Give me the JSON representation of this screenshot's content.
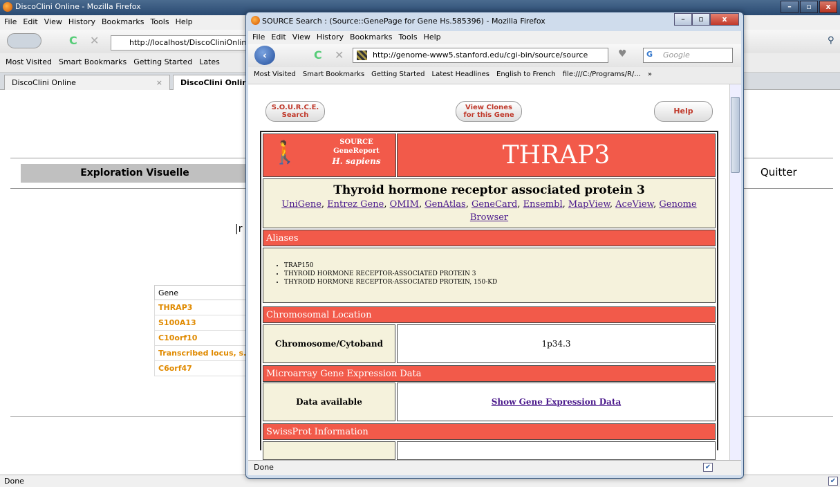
{
  "bg_window": {
    "title": "DiscoClini Online - Mozilla Firefox",
    "menu": [
      "File",
      "Edit",
      "View",
      "History",
      "Bookmarks",
      "Tools",
      "Help"
    ],
    "url": "http://localhost/DiscoCliniOnline",
    "bookmarks": [
      "Most Visited",
      "Smart Bookmarks",
      "Getting Started",
      "Lates"
    ],
    "tabs": [
      "DiscoClini Online",
      "DiscoClini Onlin"
    ],
    "explore_label": "Exploration Visuelle",
    "quit_label": "Quitter",
    "pipe_text": "|r",
    "gene_table": {
      "header": "Gene",
      "rows": [
        "THRAP3",
        "S100A13",
        "C10orf10",
        "Transcribed locus, s.",
        "C6orf47"
      ]
    },
    "status": "Done"
  },
  "popup": {
    "title": "SOURCE Search : (Source::GenePage for Gene Hs.585396) - Mozilla Firefox",
    "menu": [
      "File",
      "Edit",
      "View",
      "History",
      "Bookmarks",
      "Tools",
      "Help"
    ],
    "url": "http://genome-www5.stanford.edu/cgi-bin/source/source",
    "search_placeholder": "Google",
    "bookmarks": [
      "Most Visited",
      "Smart Bookmarks",
      "Getting Started",
      "Latest Headlines",
      "English to French",
      "file:///C:/Programs/R/...",
      "»"
    ],
    "buttons": {
      "source_search_1": "S.O.U.R.C.E.",
      "source_search_2": "Search",
      "view_clones_1": "View Clones",
      "view_clones_2": "for this Gene",
      "help": "Help"
    },
    "report": {
      "logo_line1": "SOURCE",
      "logo_line2": "GeneReport",
      "logo_species": "H. sapiens",
      "gene_symbol": "THRAP3",
      "gene_name": "Thyroid hormone receptor associated protein 3",
      "links": [
        "UniGene",
        "Entrez Gene",
        "OMIM",
        "GenAtlas",
        "GeneCard",
        "Ensembl",
        "MapView",
        "AceView",
        "Genome Browser"
      ],
      "sections": {
        "aliases": "Aliases",
        "chrom": "Chromosomal Location",
        "microarray": "Microarray Gene Expression Data",
        "swissprot": "SwissProt Information"
      },
      "aliases": [
        "TRAP150",
        "THYROID HORMONE RECEPTOR-ASSOCIATED PROTEIN 3",
        "THYROID HORMONE RECEPTOR-ASSOCIATED PROTEIN, 150-KD"
      ],
      "chrom_label": "Chromosome/Cytoband",
      "chrom_value": "1p34.3",
      "data_label": "Data available",
      "data_link": "Show Gene Expression Data"
    },
    "status": "Done"
  },
  "colors": {
    "section_red": "#f25a4a",
    "cream": "#f5f2dc",
    "link_purple": "#4b1a8c",
    "gene_orange": "#e08a00"
  }
}
